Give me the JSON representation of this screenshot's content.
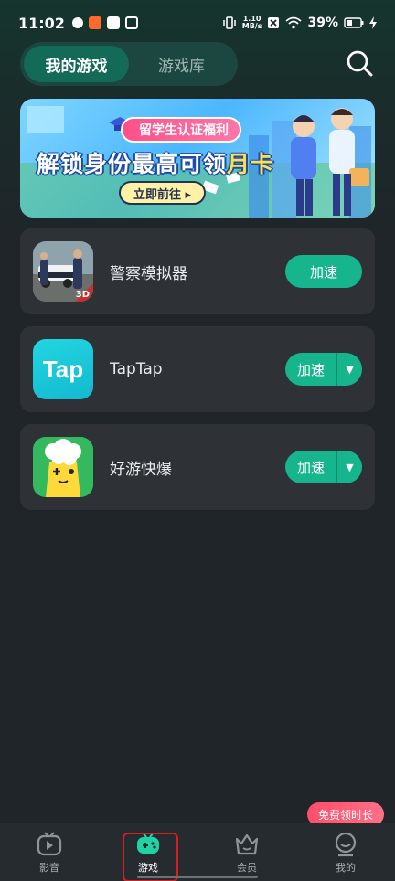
{
  "status_bar": {
    "time": "11:02",
    "net_speed_value": "1.10",
    "net_speed_unit": "MB/s",
    "battery": "39%"
  },
  "header": {
    "tabs": [
      {
        "label": "我的游戏",
        "active": true
      },
      {
        "label": "游戏库",
        "active": false
      }
    ],
    "search_icon": "search-icon"
  },
  "banner": {
    "pill": "留学生认证福利",
    "title_main": "解锁身份最高可领",
    "title_highlight": "月卡",
    "cta": "立即前往 ▸"
  },
  "games": [
    {
      "name": "警察模拟器",
      "button": "加速",
      "has_dropdown": false,
      "icon": "police-simulator-icon",
      "badge": "3D"
    },
    {
      "name": "TapTap",
      "button": "加速",
      "has_dropdown": true,
      "icon": "taptap-icon",
      "icon_text": "Tap"
    },
    {
      "name": "好游快爆",
      "button": "加速",
      "has_dropdown": true,
      "icon": "haoyou-kuaibao-icon"
    }
  ],
  "bottom_nav": {
    "items": [
      {
        "label": "影音",
        "icon": "video-icon",
        "active": false
      },
      {
        "label": "游戏",
        "icon": "gamepad-icon",
        "active": true
      },
      {
        "label": "会员",
        "icon": "crown-icon",
        "active": false
      },
      {
        "label": "我的",
        "icon": "profile-icon",
        "active": false
      }
    ],
    "promo_bubble": "免费领时长"
  },
  "colors": {
    "accent": "#16b58e",
    "active_tab": "#136a57",
    "card_bg": "#2e3236",
    "page_bg": "#1f2529"
  }
}
